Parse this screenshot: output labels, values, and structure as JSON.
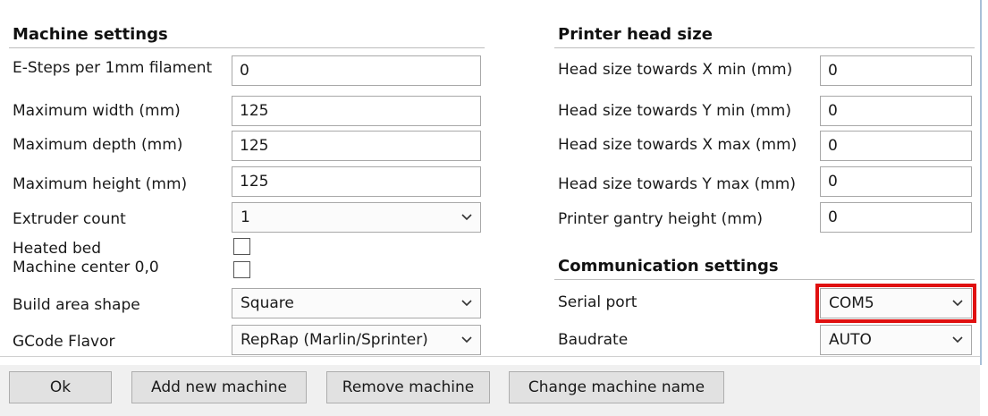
{
  "machine_settings": {
    "heading": "Machine settings",
    "esteps": {
      "label": "E-Steps per 1mm filament",
      "value": "0"
    },
    "max_width": {
      "label": "Maximum width (mm)",
      "value": "125"
    },
    "max_depth": {
      "label": "Maximum depth (mm)",
      "value": "125"
    },
    "max_height": {
      "label": "Maximum height (mm)",
      "value": "125"
    },
    "extruder_count": {
      "label": "Extruder count",
      "value": "1"
    },
    "heated_bed": {
      "label": "Heated bed",
      "checked": false
    },
    "machine_center": {
      "label": "Machine center 0,0",
      "checked": false
    },
    "build_area_shape": {
      "label": "Build area shape",
      "value": "Square"
    },
    "gcode_flavor": {
      "label": "GCode Flavor",
      "value": "RepRap (Marlin/Sprinter)"
    }
  },
  "printer_head_size": {
    "heading": "Printer head size",
    "x_min": {
      "label": "Head size towards X min (mm)",
      "value": "0"
    },
    "y_min": {
      "label": "Head size towards Y min (mm)",
      "value": "0"
    },
    "x_max": {
      "label": "Head size towards X max (mm)",
      "value": "0"
    },
    "y_max": {
      "label": "Head size towards Y max (mm)",
      "value": "0"
    },
    "gantry_height": {
      "label": "Printer gantry height (mm)",
      "value": "0"
    }
  },
  "communication_settings": {
    "heading": "Communication settings",
    "serial_port": {
      "label": "Serial port",
      "value": "COM5"
    },
    "baudrate": {
      "label": "Baudrate",
      "value": "AUTO"
    }
  },
  "buttons": {
    "ok": "Ok",
    "add_new_machine": "Add new machine",
    "remove_machine": "Remove machine",
    "change_machine_name": "Change machine name"
  },
  "colors": {
    "highlight": "#e01010",
    "border_accent": "#a8c0d8"
  }
}
